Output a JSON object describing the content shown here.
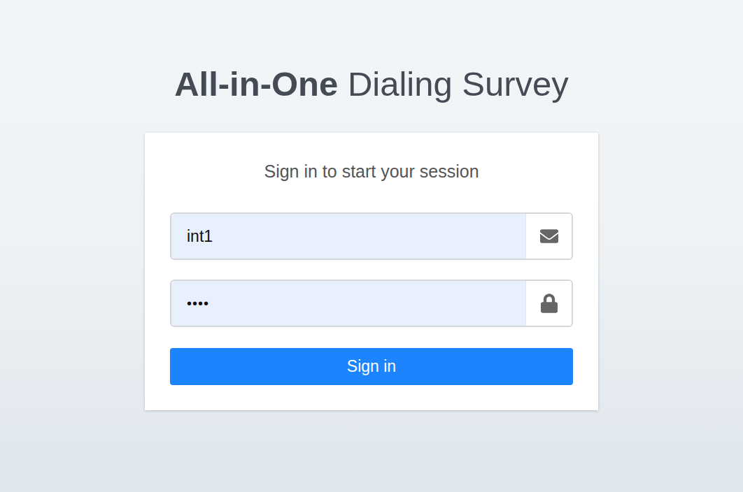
{
  "page": {
    "title_bold": "All-in-One",
    "title_light": "Dialing Survey"
  },
  "login_box": {
    "message": "Sign in to start your session",
    "fields": [
      {
        "name": "username",
        "value": "int1",
        "kind": "text"
      },
      {
        "name": "password",
        "value": "••••",
        "kind": "password"
      }
    ],
    "button": "Sign in"
  }
}
